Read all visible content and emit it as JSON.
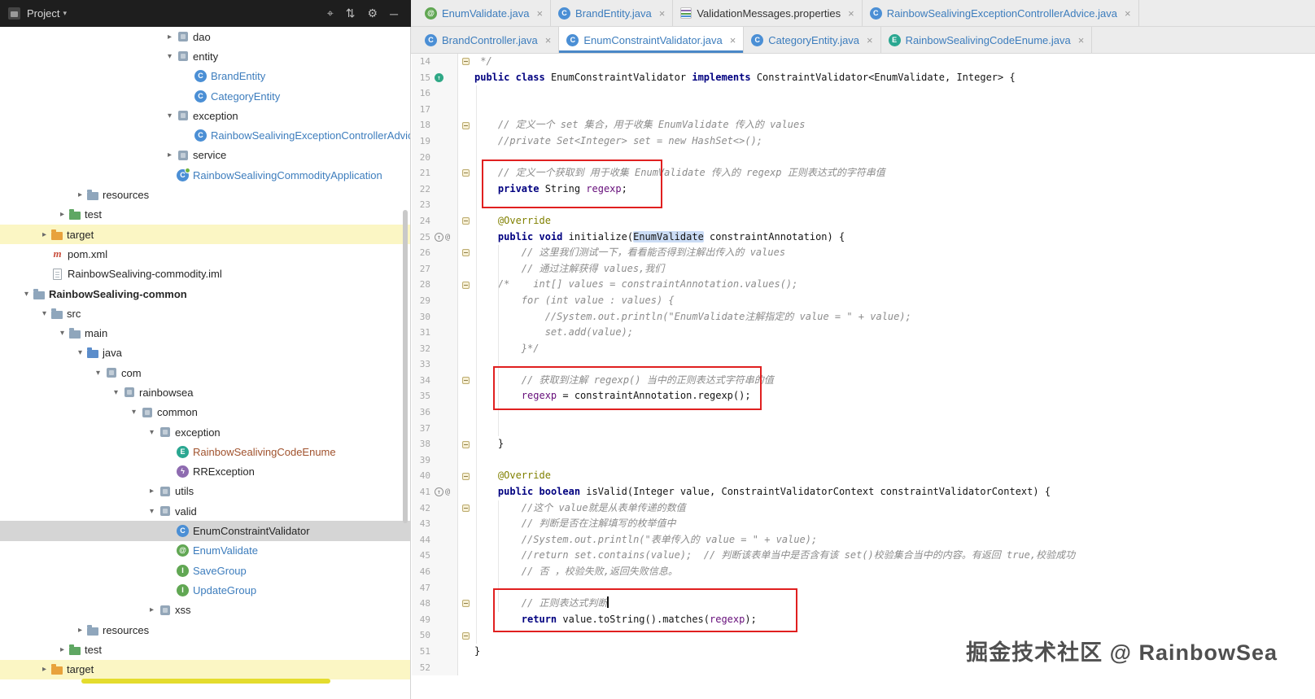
{
  "project_panel": {
    "header": {
      "title": "Project",
      "caret": "▾",
      "left_icon": "project-tool-icon",
      "icons": [
        {
          "name": "locate-file",
          "glyph": "⌖"
        },
        {
          "name": "collapse-all",
          "glyph": "⇅"
        },
        {
          "name": "settings",
          "glyph": "⚙"
        },
        {
          "name": "hide-panel",
          "glyph": "─"
        }
      ]
    },
    "colors": {
      "selection": "#D5D5D5",
      "excluded_row": "#FBF6C4",
      "modified_file": "#3D7DBD",
      "unversioned_file": "#A0522D"
    },
    "tree": [
      {
        "label": "dao",
        "level": 8,
        "arrow": "closed",
        "icon": "pkg"
      },
      {
        "label": "entity",
        "level": 8,
        "arrow": "open",
        "icon": "pkg"
      },
      {
        "label": "BrandEntity",
        "level": 9,
        "icon": "class",
        "color": "#3D7DBD"
      },
      {
        "label": "CategoryEntity",
        "level": 9,
        "icon": "class",
        "color": "#3D7DBD"
      },
      {
        "label": "exception",
        "level": 8,
        "arrow": "open",
        "icon": "pkg"
      },
      {
        "label": "RainbowSealivingExceptionControllerAdvice",
        "level": 9,
        "icon": "class",
        "color": "#3D7DBD"
      },
      {
        "label": "service",
        "level": 8,
        "arrow": "closed",
        "icon": "pkg"
      },
      {
        "label": "RainbowSealivingCommodityApplication",
        "level": 8,
        "icon": "spring",
        "color": "#3D7DBD"
      },
      {
        "label": "resources",
        "level": 3,
        "arrow": "closed",
        "icon": "folder"
      },
      {
        "label": "test",
        "level": 2,
        "arrow": "closed",
        "icon": "folder-test"
      },
      {
        "label": "target",
        "level": 1,
        "arrow": "closed",
        "icon": "folder-target",
        "bg": "yellow"
      },
      {
        "label": "pom.xml",
        "level": 1,
        "icon": "maven"
      },
      {
        "label": "RainbowSealiving-commodity.iml",
        "level": 1,
        "icon": "iml"
      },
      {
        "label": "RainbowSealiving-common",
        "level": 0,
        "arrow": "open",
        "icon": "folder",
        "bold": true
      },
      {
        "label": "src",
        "level": 1,
        "arrow": "open",
        "icon": "folder"
      },
      {
        "label": "main",
        "level": 2,
        "arrow": "open",
        "icon": "folder"
      },
      {
        "label": "java",
        "level": 3,
        "arrow": "open",
        "icon": "folder-src"
      },
      {
        "label": "com",
        "level": 4,
        "arrow": "open",
        "icon": "pkg"
      },
      {
        "label": "rainbowsea",
        "level": 5,
        "arrow": "open",
        "icon": "pkg"
      },
      {
        "label": "common",
        "level": 6,
        "arrow": "open",
        "icon": "pkg"
      },
      {
        "label": "exception",
        "level": 7,
        "arrow": "open",
        "icon": "pkg"
      },
      {
        "label": "RainbowSealivingCodeEnume",
        "level": 8,
        "icon": "enum",
        "color": "#A0522D"
      },
      {
        "label": "RRException",
        "level": 8,
        "icon": "exception"
      },
      {
        "label": "utils",
        "level": 7,
        "arrow": "closed",
        "icon": "pkg"
      },
      {
        "label": "valid",
        "level": 7,
        "arrow": "open",
        "icon": "pkg"
      },
      {
        "label": "EnumConstraintValidator",
        "level": 8,
        "icon": "class",
        "bg": "selected"
      },
      {
        "label": "EnumValidate",
        "level": 8,
        "icon": "annotation",
        "color": "#3D7DBD"
      },
      {
        "label": "SaveGroup",
        "level": 8,
        "icon": "interface",
        "color": "#3D7DBD"
      },
      {
        "label": "UpdateGroup",
        "level": 8,
        "icon": "interface",
        "color": "#3D7DBD"
      },
      {
        "label": "xss",
        "level": 7,
        "arrow": "closed",
        "icon": "pkg"
      },
      {
        "label": "resources",
        "level": 3,
        "arrow": "closed",
        "icon": "folder"
      },
      {
        "label": "test",
        "level": 2,
        "arrow": "closed",
        "icon": "folder-test"
      },
      {
        "label": "target",
        "level": 1,
        "arrow": "closed",
        "icon": "folder-target",
        "bg": "yellow"
      }
    ]
  },
  "editor_tabs": {
    "close_glyph": "×",
    "row1": [
      {
        "label": "EnumValidate.java",
        "icon": "annotation",
        "color": "#3D7DBD"
      },
      {
        "label": "BrandEntity.java",
        "icon": "class",
        "color": "#3D7DBD"
      },
      {
        "label": "ValidationMessages.properties",
        "icon": "properties",
        "color": "#333333"
      },
      {
        "label": "RainbowSealivingExceptionControllerAdvice.java",
        "icon": "class",
        "color": "#3D7DBD"
      }
    ],
    "row2": [
      {
        "label": "BrandController.java",
        "icon": "class",
        "color": "#3D7DBD"
      },
      {
        "label": "EnumConstraintValidator.java",
        "icon": "class",
        "color": "#3D7DBD",
        "active": true
      },
      {
        "label": "CategoryEntity.java",
        "icon": "class",
        "color": "#3D7DBD"
      },
      {
        "label": "RainbowSealivingCodeEnume.java",
        "icon": "enum",
        "color": "#3D7DBD"
      }
    ]
  },
  "editor": {
    "annotation_box_color": "#E02020",
    "caret_line": 48,
    "fold_lines": [
      14,
      18,
      21,
      24,
      26,
      28,
      34,
      38,
      40,
      42,
      48,
      50
    ],
    "gutter": {
      "15": [
        "impl"
      ],
      "25": [
        "override",
        "at"
      ],
      "41": [
        "override",
        "at"
      ]
    },
    "lines": [
      {
        "n": 14,
        "t": [
          [
            "cmt",
            " */"
          ]
        ]
      },
      {
        "n": 15,
        "t": [
          [
            "kw",
            "public"
          ],
          [
            "pln",
            " "
          ],
          [
            "kw",
            "class"
          ],
          [
            "pln",
            " EnumConstraintValidator "
          ],
          [
            "kw",
            "implements"
          ],
          [
            "pln",
            " ConstraintValidator<EnumValidate, Integer> {"
          ]
        ]
      },
      {
        "n": 16,
        "t": []
      },
      {
        "n": 17,
        "t": []
      },
      {
        "n": 18,
        "t": [
          [
            "pln",
            "    "
          ],
          [
            "cmt",
            "// 定义一个 set 集合，用于收集 EnumValidate 传入的 values"
          ]
        ]
      },
      {
        "n": 19,
        "t": [
          [
            "pln",
            "    "
          ],
          [
            "cmt",
            "//private Set<Integer> set = new HashSet<>();"
          ]
        ]
      },
      {
        "n": 20,
        "t": []
      },
      {
        "n": 21,
        "t": [
          [
            "pln",
            "    "
          ],
          [
            "cmt",
            "// 定义一个获取到 用于收集 EnumValidate 传入的 regexp 正则表达式的字符串值"
          ]
        ]
      },
      {
        "n": 22,
        "t": [
          [
            "pln",
            "    "
          ],
          [
            "kw",
            "private"
          ],
          [
            "pln",
            " String "
          ],
          [
            "fld",
            "regexp"
          ],
          [
            "pln",
            ";"
          ]
        ]
      },
      {
        "n": 23,
        "t": []
      },
      {
        "n": 24,
        "t": [
          [
            "pln",
            "    "
          ],
          [
            "ann",
            "@Override"
          ]
        ]
      },
      {
        "n": 25,
        "t": [
          [
            "pln",
            "    "
          ],
          [
            "kw",
            "public"
          ],
          [
            "pln",
            " "
          ],
          [
            "kw",
            "void"
          ],
          [
            "pln",
            " initialize("
          ],
          [
            "hl",
            "EnumValidate"
          ],
          [
            "pln",
            " constraintAnnotation) {"
          ]
        ]
      },
      {
        "n": 26,
        "t": [
          [
            "pln",
            "        "
          ],
          [
            "cmt",
            "// 这里我们测试一下，看看能否得到注解出传入的 values"
          ]
        ]
      },
      {
        "n": 27,
        "t": [
          [
            "pln",
            "        "
          ],
          [
            "cmt",
            "// 通过注解获得 values,我们"
          ]
        ]
      },
      {
        "n": 28,
        "t": [
          [
            "pln",
            "    "
          ],
          [
            "cmt",
            "/*    int[] values = constraintAnnotation.values();"
          ]
        ]
      },
      {
        "n": 29,
        "t": [
          [
            "pln",
            "        "
          ],
          [
            "cmt",
            "for (int value : values) {"
          ]
        ]
      },
      {
        "n": 30,
        "t": [
          [
            "pln",
            "            "
          ],
          [
            "cmt",
            "//System.out.println(\"EnumValidate注解指定的 value = \" + value);"
          ]
        ]
      },
      {
        "n": 31,
        "t": [
          [
            "pln",
            "            "
          ],
          [
            "cmt",
            "set.add(value);"
          ]
        ]
      },
      {
        "n": 32,
        "t": [
          [
            "pln",
            "        "
          ],
          [
            "cmt",
            "}*/"
          ]
        ]
      },
      {
        "n": 33,
        "t": []
      },
      {
        "n": 34,
        "t": [
          [
            "pln",
            "        "
          ],
          [
            "cmt",
            "// 获取到注解 regexp() 当中的正则表达式字符串的值"
          ]
        ]
      },
      {
        "n": 35,
        "t": [
          [
            "pln",
            "        "
          ],
          [
            "fld",
            "regexp"
          ],
          [
            "pln",
            " = constraintAnnotation.regexp();"
          ]
        ]
      },
      {
        "n": 36,
        "t": []
      },
      {
        "n": 37,
        "t": []
      },
      {
        "n": 38,
        "t": [
          [
            "pln",
            "    }"
          ]
        ]
      },
      {
        "n": 39,
        "t": []
      },
      {
        "n": 40,
        "t": [
          [
            "pln",
            "    "
          ],
          [
            "ann",
            "@Override"
          ]
        ]
      },
      {
        "n": 41,
        "t": [
          [
            "pln",
            "    "
          ],
          [
            "kw",
            "public"
          ],
          [
            "pln",
            " "
          ],
          [
            "kw",
            "boolean"
          ],
          [
            "pln",
            " isValid(Integer value, ConstraintValidatorContext constraintValidatorContext) {"
          ]
        ]
      },
      {
        "n": 42,
        "t": [
          [
            "pln",
            "        "
          ],
          [
            "cmt",
            "//这个 value就是从表单传递的数值"
          ]
        ]
      },
      {
        "n": 43,
        "t": [
          [
            "pln",
            "        "
          ],
          [
            "cmt",
            "// 判断是否在注解填写的枚举值中"
          ]
        ]
      },
      {
        "n": 44,
        "t": [
          [
            "pln",
            "        "
          ],
          [
            "cmt",
            "//System.out.println(\"表单传入的 value = \" + value);"
          ]
        ]
      },
      {
        "n": 45,
        "t": [
          [
            "pln",
            "        "
          ],
          [
            "cmt",
            "//return set.contains(value);  // 判断该表单当中是否含有该 set()校验集合当中的内容。有返回 true,校验成功"
          ]
        ]
      },
      {
        "n": 46,
        "t": [
          [
            "pln",
            "        "
          ],
          [
            "cmt",
            "// 否 ，校验失败,返回失败信息。"
          ]
        ]
      },
      {
        "n": 47,
        "t": []
      },
      {
        "n": 48,
        "t": [
          [
            "pln",
            "        "
          ],
          [
            "cmt",
            "// 正则表达式判断"
          ],
          [
            "caret",
            ""
          ]
        ]
      },
      {
        "n": 49,
        "t": [
          [
            "pln",
            "        "
          ],
          [
            "kw",
            "return"
          ],
          [
            "pln",
            " value.toString().matches("
          ],
          [
            "fld",
            "regexp"
          ],
          [
            "pln",
            ");"
          ]
        ]
      },
      {
        "n": 50,
        "t": []
      },
      {
        "n": 51,
        "t": [
          [
            "pln",
            "}"
          ]
        ]
      },
      {
        "n": 52,
        "t": []
      }
    ]
  },
  "watermark": "掘金技术社区 @ RainbowSea"
}
